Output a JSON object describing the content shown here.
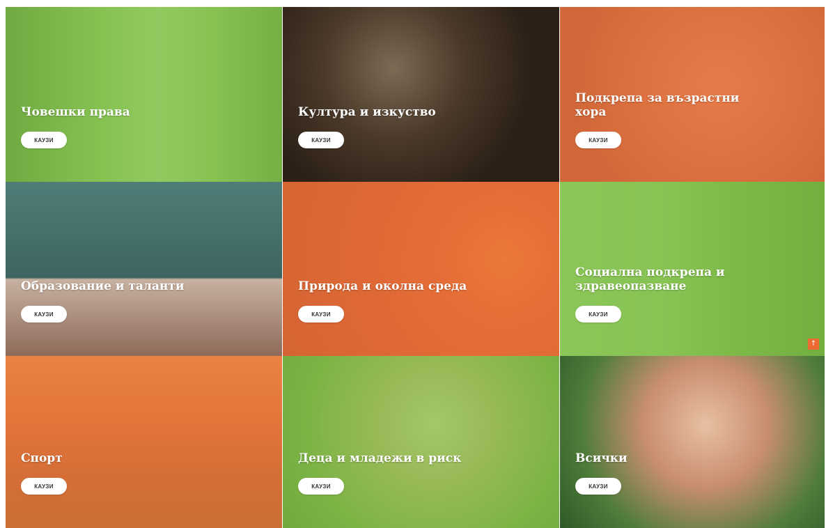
{
  "colors": {
    "green_overlay": "#84c44a",
    "orange_overlay": "#e9703a",
    "button_bg": "#ffffff",
    "scroll_top_bg": "#ef6a33"
  },
  "tiles": [
    {
      "title": "Човешки права",
      "button": "КАУЗИ"
    },
    {
      "title": "Култура и изкуство",
      "button": "КАУЗИ"
    },
    {
      "title": "Подкрепа за възрастни хора",
      "button": "КАУЗИ"
    },
    {
      "title": "Образование и таланти",
      "button": "КАУЗИ"
    },
    {
      "title": "Природа и околна среда",
      "button": "КАУЗИ"
    },
    {
      "title": "Социална подкрепа и здравеопазване",
      "button": "КАУЗИ"
    },
    {
      "title": "Спорт",
      "button": "КАУЗИ"
    },
    {
      "title": "Деца и младежи в риск",
      "button": "КАУЗИ"
    },
    {
      "title": "Всички",
      "button": "КАУЗИ"
    }
  ],
  "scroll_top": {
    "icon": "arrow-up-icon",
    "glyph": "↑"
  }
}
